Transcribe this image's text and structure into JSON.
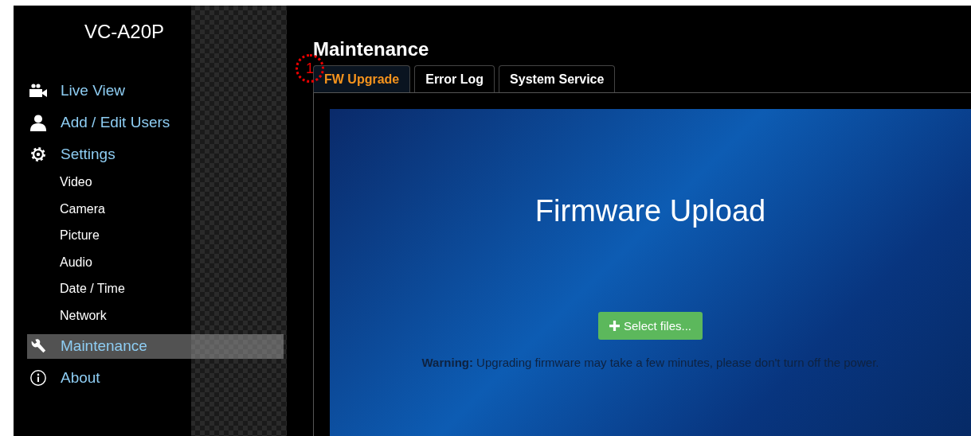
{
  "sidebar": {
    "brand": "VC-A20P",
    "items": [
      {
        "label": "Live View",
        "selected": false
      },
      {
        "label": "Add / Edit Users",
        "selected": false
      },
      {
        "label": "Settings",
        "selected": false,
        "children": [
          {
            "label": "Video"
          },
          {
            "label": "Camera"
          },
          {
            "label": "Picture"
          },
          {
            "label": "Audio"
          },
          {
            "label": "Date / Time"
          },
          {
            "label": "Network"
          }
        ]
      },
      {
        "label": "Maintenance",
        "selected": true
      },
      {
        "label": "About",
        "selected": false
      }
    ]
  },
  "page_title": "Maintenance",
  "callout": "1",
  "tabs": [
    {
      "label": "FW Upgrade",
      "selected": true
    },
    {
      "label": "Error Log",
      "selected": false
    },
    {
      "label": "System Service",
      "selected": false
    }
  ],
  "upload": {
    "heading": "Firmware Upload",
    "button": "Select files...",
    "warning": "**Warning:** Upgrading firmware may take a few minutes, please don't turn off the power."
  }
}
